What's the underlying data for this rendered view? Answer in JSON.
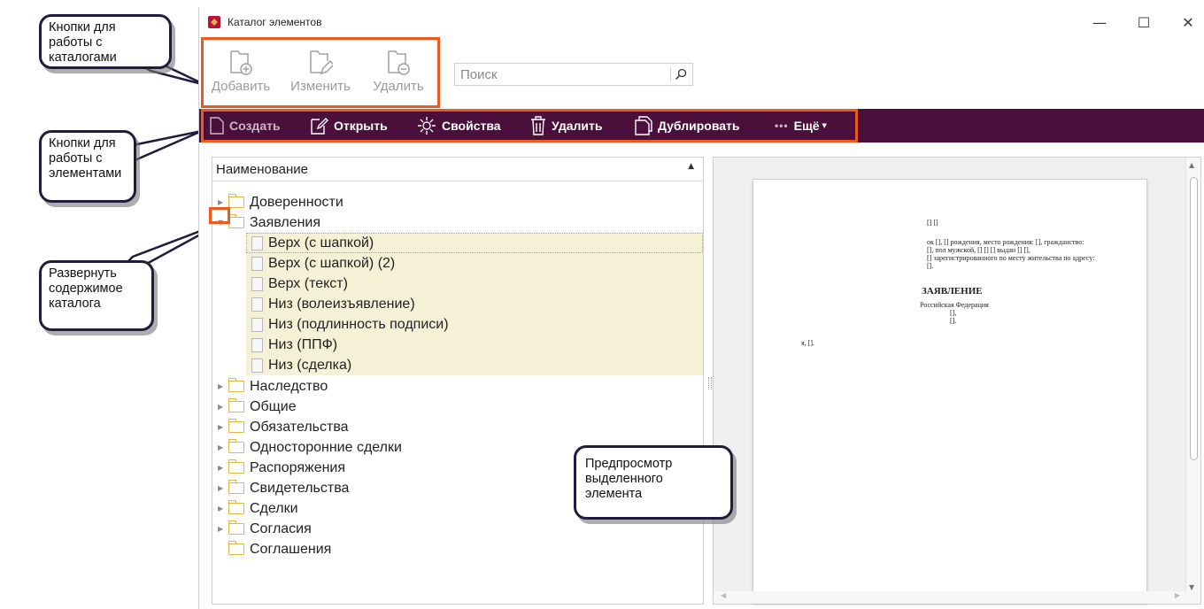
{
  "window": {
    "title": "Каталог элементов",
    "controls": {
      "minimize": "—",
      "maximize": "☐",
      "close": "✕"
    }
  },
  "catalog_buttons": {
    "add": "Добавить",
    "edit": "Изменить",
    "delete": "Удалить"
  },
  "search": {
    "placeholder": "Поиск"
  },
  "toolbar": {
    "create": "Создать",
    "open": "Открыть",
    "properties": "Свойства",
    "delete": "Удалить",
    "duplicate": "Дублировать",
    "more": "Ещё"
  },
  "tree": {
    "header": "Наименование",
    "folders": [
      {
        "label": "Доверенности"
      },
      {
        "label": "Заявления"
      },
      {
        "label": "Наследство"
      },
      {
        "label": "Общие"
      },
      {
        "label": "Обязательства"
      },
      {
        "label": "Односторонние сделки"
      },
      {
        "label": "Распоряжения"
      },
      {
        "label": "Свидетельства"
      },
      {
        "label": "Сделки"
      },
      {
        "label": "Согласия"
      },
      {
        "label": "Соглашения"
      }
    ],
    "children": [
      {
        "label": "Верх (с шапкой)"
      },
      {
        "label": "Верх (с шапкой) (2)"
      },
      {
        "label": "Верх (текст)"
      },
      {
        "label": "Низ (волеизъявление)"
      },
      {
        "label": "Низ (подлинность подписи)"
      },
      {
        "label": "Низ (ППФ)"
      },
      {
        "label": "Низ (сделка)"
      }
    ]
  },
  "preview": {
    "line1": "[] []",
    "line2": "ок [], [] рождения, место рождения: [], гражданство:",
    "line3": "[], пол мужской, [] [] [] выдан [] [],",
    "line4": "[] зарегистрированного по месту жительства по адресу:",
    "line5": "[].",
    "title": "ЗАЯВЛЕНИЕ",
    "line6": "Российская Федерация",
    "line7": "[],",
    "line8": "[].",
    "line9": "я, []."
  },
  "callouts": {
    "catalog": "Кнопки для работы с каталогами",
    "elements": "Кнопки для работы с элементами",
    "expand": "Развернуть содержимое каталога",
    "preview": "Предпросмотр выделенного элемента"
  },
  "colors": {
    "toolbar_bg": "#4a0f3a",
    "highlight_frame": "#ec5a1f",
    "selection_bg": "#f4f1d6"
  }
}
